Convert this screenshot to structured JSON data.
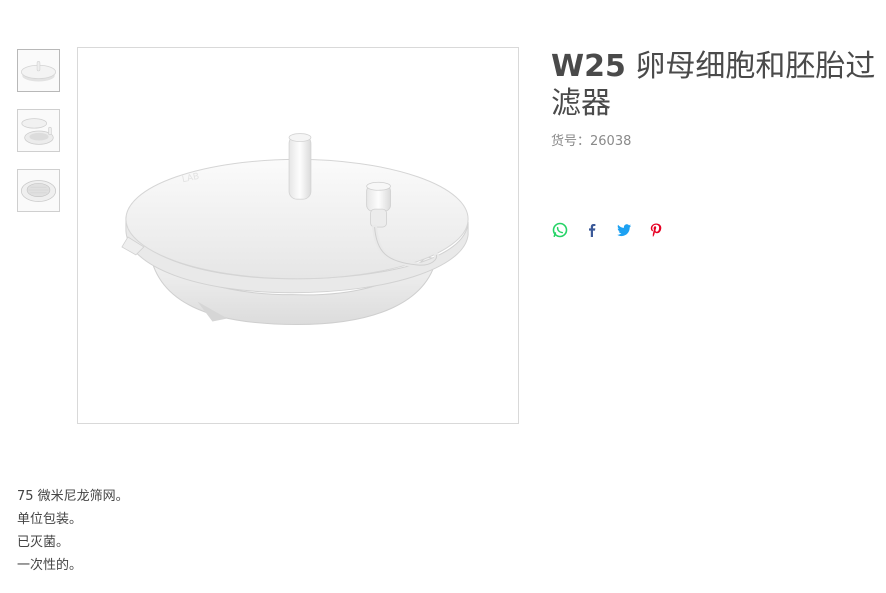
{
  "product": {
    "code": "W25",
    "name_line1": "卵母细胞和胚胎过",
    "name_line2": "滤器",
    "sku_label": "货号：",
    "sku_value": "26038"
  },
  "thumbnails": [
    {
      "icon": "product-photo-filter-closed"
    },
    {
      "icon": "product-photo-filter-open"
    },
    {
      "icon": "product-photo-filter-mesh"
    }
  ],
  "share": [
    {
      "icon": "whatsapp-icon",
      "color": "#25D366"
    },
    {
      "icon": "facebook-icon",
      "color": "#3B5998"
    },
    {
      "icon": "twitter-icon",
      "color": "#1DA1F2"
    },
    {
      "icon": "pinterest-icon",
      "color": "#E60023"
    }
  ],
  "description": [
    "75 微米尼龙筛网。",
    "单位包装。",
    "已灭菌。",
    "一次性的。"
  ]
}
